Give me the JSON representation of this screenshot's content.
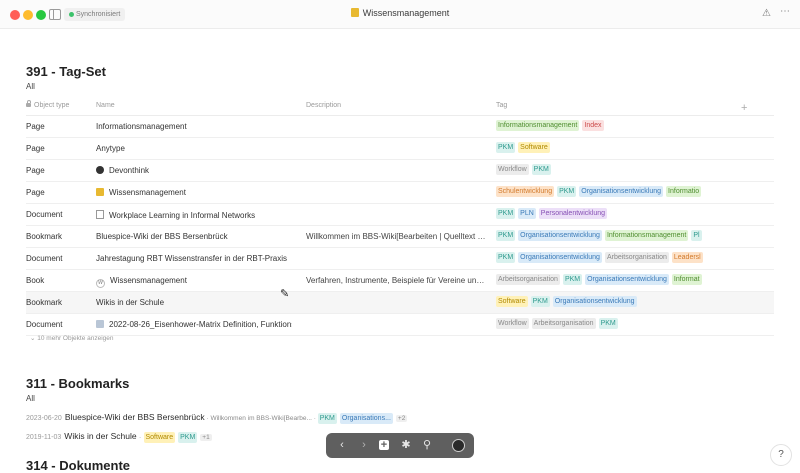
{
  "window": {
    "title": "Wissensmanagement",
    "sync_status": "Synchronisiert"
  },
  "set1": {
    "title": "391 - Tag-Set",
    "view": "All",
    "columns": {
      "type": "Object type",
      "name": "Name",
      "description": "Description",
      "tag": "Tag"
    },
    "rows": [
      {
        "type": "Page",
        "name": "Informationsmanagement",
        "description": "",
        "icon": "none",
        "tags": [
          {
            "label": "Informationsmanagement",
            "color": "green"
          },
          {
            "label": "Index",
            "color": "red"
          }
        ]
      },
      {
        "type": "Page",
        "name": "Anytype",
        "description": "",
        "icon": "none",
        "tags": [
          {
            "label": "PKM",
            "color": "teal"
          },
          {
            "label": "Software",
            "color": "yellow"
          }
        ]
      },
      {
        "type": "Page",
        "name": "Devonthink",
        "description": "",
        "icon": "circle",
        "tags": [
          {
            "label": "Workflow",
            "color": "grey"
          },
          {
            "label": "PKM",
            "color": "teal"
          }
        ]
      },
      {
        "type": "Page",
        "name": "Wissensmanagement",
        "description": "",
        "icon": "folder",
        "tags": [
          {
            "label": "Schulentwicklung",
            "color": "orange"
          },
          {
            "label": "PKM",
            "color": "teal"
          },
          {
            "label": "Organisationsentwicklung",
            "color": "blue"
          },
          {
            "label": "Informatio",
            "color": "green"
          }
        ]
      },
      {
        "type": "Document",
        "name": "Workplace Learning in Informal Networks",
        "description": "",
        "icon": "doc",
        "tags": [
          {
            "label": "PKM",
            "color": "teal"
          },
          {
            "label": "PLN",
            "color": "blue"
          },
          {
            "label": "Personalentwicklung",
            "color": "purple"
          }
        ]
      },
      {
        "type": "Bookmark",
        "name": "Bluespice-Wiki der BBS Bersenbrück",
        "description": "Willkommen im BBS-Wiki[Bearbeiten | Quelltext b...",
        "icon": "none",
        "tags": [
          {
            "label": "PKM",
            "color": "teal"
          },
          {
            "label": "Organisationsentwicklung",
            "color": "blue"
          },
          {
            "label": "Informationsmanagement",
            "color": "green"
          },
          {
            "label": "Pl",
            "color": "teal"
          }
        ]
      },
      {
        "type": "Document",
        "name": "Jahrestagung RBT Wissenstransfer in der RBT-Praxis",
        "description": "",
        "icon": "none",
        "tags": [
          {
            "label": "PKM",
            "color": "teal"
          },
          {
            "label": "Organisationsentwicklung",
            "color": "blue"
          },
          {
            "label": "Arbeitsorganisation",
            "color": "grey"
          },
          {
            "label": "Leadersl",
            "color": "orange"
          }
        ]
      },
      {
        "type": "Book",
        "name": "Wissensmanagement",
        "description": "Verfahren, Instrumente, Beispiele für Vereine und...",
        "icon": "w",
        "tags": [
          {
            "label": "Arbeitsorganisation",
            "color": "grey"
          },
          {
            "label": "PKM",
            "color": "teal"
          },
          {
            "label": "Organisationsentwicklung",
            "color": "blue"
          },
          {
            "label": "Informat",
            "color": "green"
          }
        ]
      },
      {
        "type": "Bookmark",
        "name": "Wikis in der Schule",
        "description": "",
        "icon": "none",
        "highlight": true,
        "tags": [
          {
            "label": "Software",
            "color": "yellow"
          },
          {
            "label": "PKM",
            "color": "teal"
          },
          {
            "label": "Organisationsentwicklung",
            "color": "blue"
          }
        ]
      },
      {
        "type": "Document",
        "name": "2022-08-26_Eisenhower-Matrix Definition, Funktionsv",
        "description": "",
        "icon": "book",
        "tags": [
          {
            "label": "Workflow",
            "color": "grey"
          },
          {
            "label": "Arbeitsorganisation",
            "color": "grey"
          },
          {
            "label": "PKM",
            "color": "teal"
          }
        ]
      }
    ],
    "more_link": "10 mehr Objekte anzeigen"
  },
  "set2": {
    "title": "311 - Bookmarks",
    "view": "All",
    "items": [
      {
        "date": "2023-06-20",
        "name": "Bluespice-Wiki der BBS Bersenbrück",
        "description": "Willkommen im BBS-Wiki[Bearbe...",
        "tags": [
          {
            "label": "PKM",
            "color": "teal"
          },
          {
            "label": "Organisations...",
            "color": "blue"
          }
        ],
        "extra": "+2"
      },
      {
        "date": "2019-11-03",
        "name": "Wikis in der Schule",
        "description": "",
        "tags": [
          {
            "label": "Software",
            "color": "yellow"
          },
          {
            "label": "PKM",
            "color": "teal"
          }
        ],
        "extra": "+1"
      }
    ]
  },
  "set3": {
    "title": "314 - Dokumente"
  },
  "toolbar": {
    "back": "‹",
    "forward": "›",
    "graph": "✱",
    "search": "⚲"
  },
  "help": {
    "label": "?"
  }
}
